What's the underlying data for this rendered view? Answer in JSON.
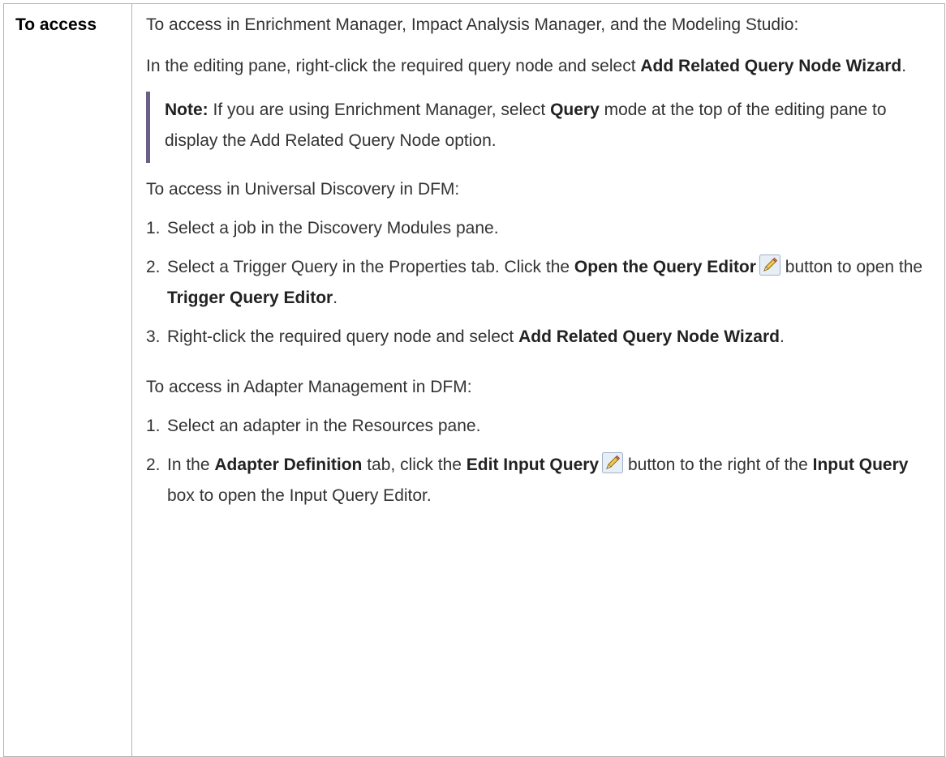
{
  "label": "To access",
  "section1": {
    "intro": "To access in Enrichment Manager, Impact Analysis Manager, and the Modeling Studio:",
    "para": {
      "pre": "In the editing pane, right-click the required query node and select ",
      "bold": "Add Related Query Node Wizard",
      "post": "."
    },
    "note": {
      "label": "Note:",
      "pre": " If you are using Enrichment Manager, select ",
      "bold": "Query",
      "post": " mode at the top of the editing pane to display the Add Related Query Node option."
    }
  },
  "section2": {
    "intro": "To access in Universal Discovery in DFM:",
    "steps": [
      {
        "num": "1.",
        "text": "Select a job in the Discovery Modules pane."
      },
      {
        "num": "2.",
        "pre": "Select a Trigger Query in the Properties tab. Click the ",
        "bold1": "Open the Query Editor",
        "mid": " button to open the ",
        "bold2": "Trigger Query Editor",
        "post": "."
      },
      {
        "num": "3.",
        "pre": "Right-click the required query node and select ",
        "bold": "Add Related Query Node Wizard",
        "post": "."
      }
    ]
  },
  "section3": {
    "intro": "To access in Adapter Management in DFM:",
    "steps": [
      {
        "num": "1.",
        "text": "Select an adapter in the Resources pane."
      },
      {
        "num": "2.",
        "pre": "In the ",
        "bold1": "Adapter Definition",
        "mid1": " tab, click the ",
        "bold2": "Edit Input Query",
        "mid2": " button to the right of the ",
        "bold3": "Input Query",
        "post": " box to open the Input Query Editor."
      }
    ]
  },
  "icons": {
    "edit": "pencil-icon"
  }
}
